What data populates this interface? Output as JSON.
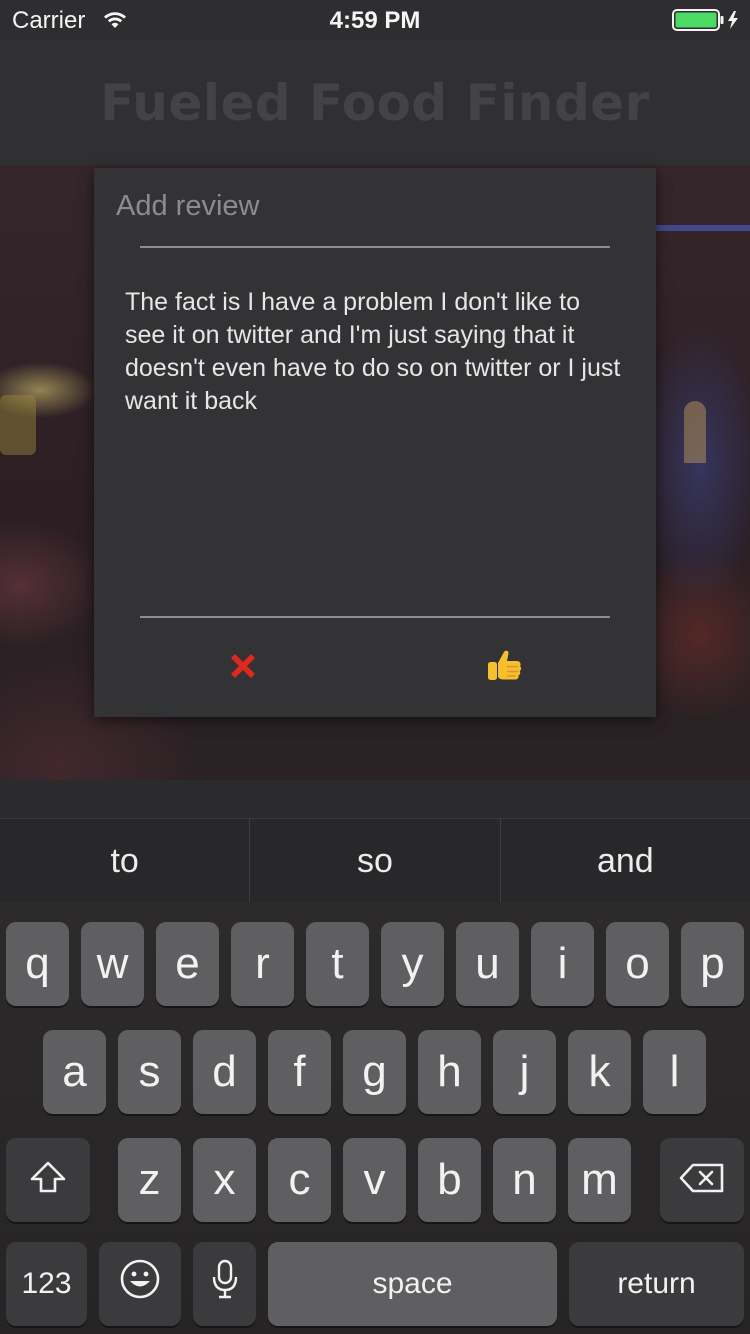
{
  "status_bar": {
    "carrier": "Carrier",
    "time": "4:59 PM",
    "wifi_icon": "wifi-icon",
    "battery_icon": "battery-charging-icon"
  },
  "app": {
    "title": "Fueled Food Finder"
  },
  "dialog": {
    "title": "Add review",
    "review_text": "The fact is I have a problem I don't like to see it on twitter and I'm just saying that it doesn't even have to do so on twitter or I just want it back",
    "cancel_icon": "red-x-icon",
    "confirm_icon": "thumbs-up-icon",
    "colors": {
      "cancel": "#e0281e",
      "confirm": "#f5bf2e"
    }
  },
  "keyboard": {
    "suggestions": [
      "to",
      "so",
      "and"
    ],
    "row1": [
      "q",
      "w",
      "e",
      "r",
      "t",
      "y",
      "u",
      "i",
      "o",
      "p"
    ],
    "row2": [
      "a",
      "s",
      "d",
      "f",
      "g",
      "h",
      "j",
      "k",
      "l"
    ],
    "row3": [
      "z",
      "x",
      "c",
      "v",
      "b",
      "n",
      "m"
    ],
    "shift_icon": "shift-arrow-icon",
    "delete_icon": "backspace-icon",
    "numbers_label": "123",
    "emoji_icon": "emoji-smiley-icon",
    "mic_icon": "microphone-icon",
    "space_label": "space",
    "return_label": "return"
  }
}
